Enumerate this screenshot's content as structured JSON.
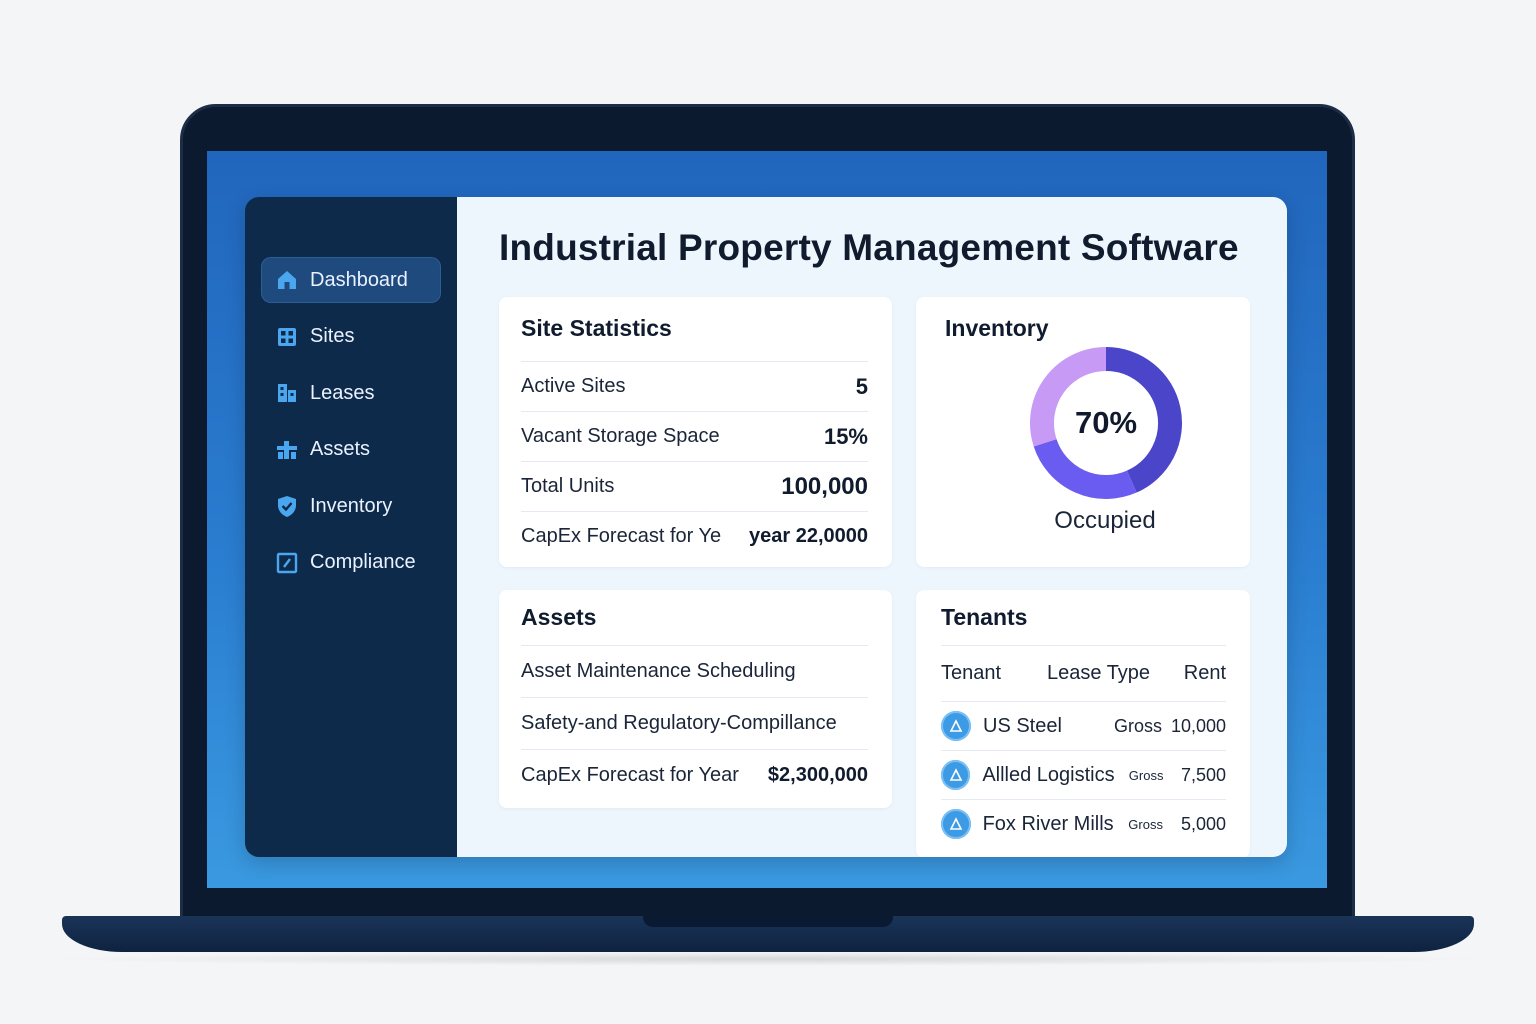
{
  "sidebar": {
    "items": [
      {
        "label": "Dashboard",
        "icon": "home-icon"
      },
      {
        "label": "Sites",
        "icon": "building-grid-icon"
      },
      {
        "label": "Leases",
        "icon": "buildings-icon"
      },
      {
        "label": "Assets",
        "icon": "crane-icon"
      },
      {
        "label": "Inventory",
        "icon": "shield-check-icon"
      },
      {
        "label": "Compliance",
        "icon": "edit-square-icon"
      }
    ],
    "active_index": 0
  },
  "main": {
    "title": "Industrial Property Management Software"
  },
  "site_statistics": {
    "title": "Site Statistics",
    "rows": [
      {
        "label": "Active Sites",
        "value": "5"
      },
      {
        "label": "Vacant Storage Space",
        "value": "15%"
      },
      {
        "label": "Total Units",
        "value": "100,000"
      },
      {
        "label": "CapEx Forecast for Ye",
        "value": "year 22,0000"
      }
    ]
  },
  "inventory": {
    "title": "Inventory",
    "percent_label": "70%",
    "percent_value": 70,
    "caption": "Occupied",
    "colors": {
      "primary": "#4a45c9",
      "secondary": "#6a5cf0",
      "remainder": "#c79af5"
    }
  },
  "assets": {
    "title": "Assets",
    "rows": [
      {
        "label": "Asset Maintenance Scheduling",
        "value": ""
      },
      {
        "label": "Safety-and Regulatory-Compillance",
        "value": ""
      },
      {
        "label": "CapEx Forecast for Year",
        "value": "$2,300,000"
      }
    ]
  },
  "tenants": {
    "title": "Tenants",
    "headers": {
      "tenant": "Tenant",
      "lease_type": "Lease Type",
      "rent": "Rent"
    },
    "rows": [
      {
        "name": "US Steel",
        "lease_type": "Gross",
        "rent": "10,000"
      },
      {
        "name": "Allled Logistics",
        "lease_type": "Gross",
        "rent": "7,500"
      },
      {
        "name": "Fox River Mills",
        "lease_type": "Gross",
        "rent": "5,000"
      }
    ]
  },
  "theme": {
    "sidebar_bg": "#0d2a4a",
    "accent": "#3d9be6",
    "screen_blue": "#2166bd"
  }
}
